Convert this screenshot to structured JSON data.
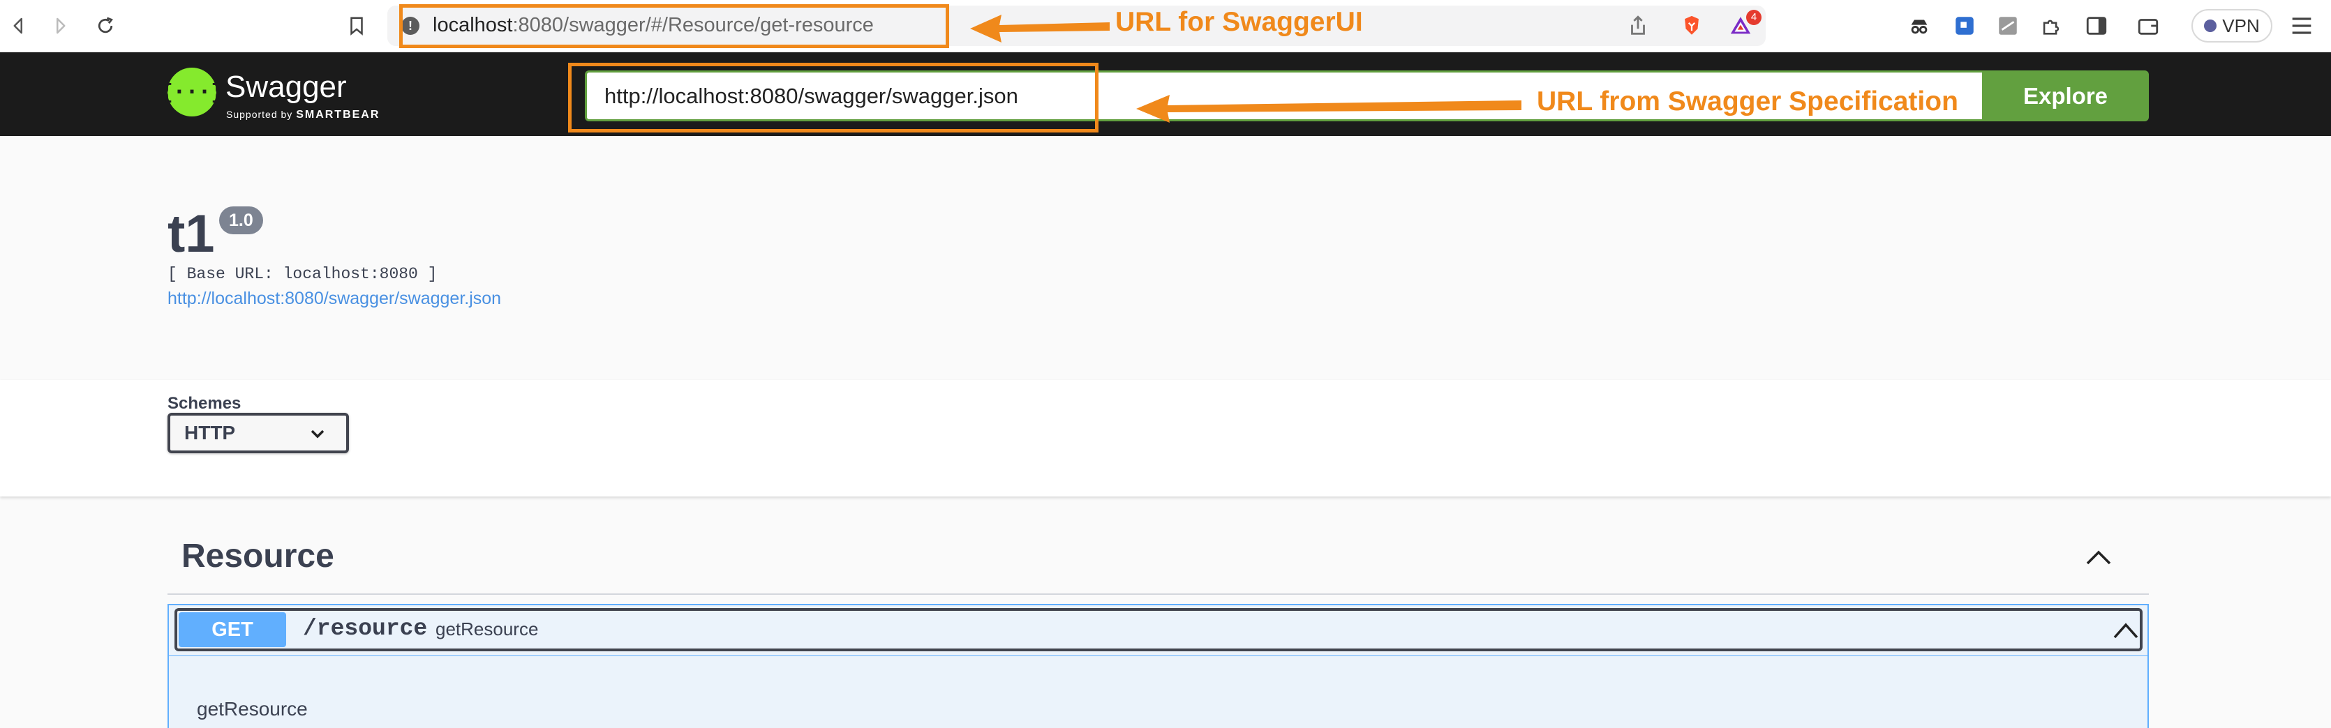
{
  "browser": {
    "url_host": "localhost",
    "url_rest": ":8080/swagger/#/Resource/get-resource",
    "vpn_label": "VPN",
    "notification_count": "4"
  },
  "annotations": {
    "swaggerui_url_label": "URL for SwaggerUI",
    "spec_url_label": "URL from Swagger Specification",
    "color": "#f0891b"
  },
  "topbar": {
    "logo_title": "Swagger",
    "logo_sub_prefix": "Supported by",
    "logo_sub_brand": "SMARTBEAR",
    "spec_url": "http://localhost:8080/swagger/swagger.json",
    "explore_label": "Explore"
  },
  "info": {
    "title": "t1",
    "version": "1.0",
    "base_url": "[ Base URL: localhost:8080 ]",
    "spec_link": "http://localhost:8080/swagger/swagger.json"
  },
  "schemes": {
    "label": "Schemes",
    "selected": "HTTP"
  },
  "resource": {
    "tag": "Resource",
    "operation": {
      "method": "GET",
      "path": "/resource",
      "summary": "getResource",
      "description": "getResource"
    }
  },
  "colors": {
    "swagger_green": "#85ea2d",
    "explore_green": "#62a03f",
    "get_blue": "#61affe",
    "text_dark": "#3b4151"
  }
}
